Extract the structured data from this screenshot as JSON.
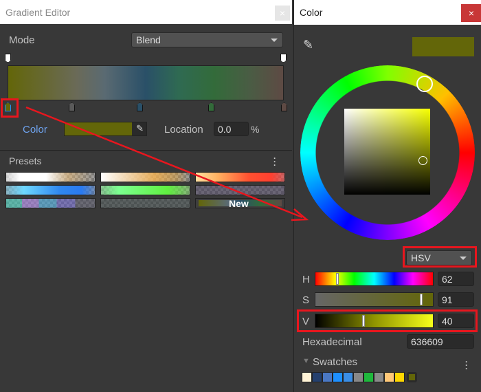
{
  "gradient_editor": {
    "title": "Gradient Editor",
    "close_label": "×",
    "mode_label": "Mode",
    "mode_value": "Blend",
    "color_label": "Color",
    "location_label": "Location",
    "location_value": "0.0",
    "location_unit": "%",
    "presets_label": "Presets",
    "new_label": "New",
    "selected_color": "#636609",
    "gradient_colors": [
      "#636609",
      "#5a5a5a",
      "#2a5068",
      "#336b3a",
      "#5e4a44"
    ]
  },
  "color_picker": {
    "title": "Color",
    "close_label": "×",
    "model": "HSV",
    "h_label": "H",
    "h_value": "62",
    "s_label": "S",
    "s_value": "91",
    "v_label": "V",
    "v_value": "40",
    "hex_label": "Hexadecimal",
    "hex_value": "636609",
    "swatches_label": "Swatches",
    "swatch_colors": [
      "#fff3d6",
      "#24406e",
      "#4a78c4",
      "#1e90ff",
      "#3a8ee6",
      "#888888",
      "#1eb83c",
      "#8a8a8a",
      "#ffc878",
      "#ffd700"
    ]
  }
}
